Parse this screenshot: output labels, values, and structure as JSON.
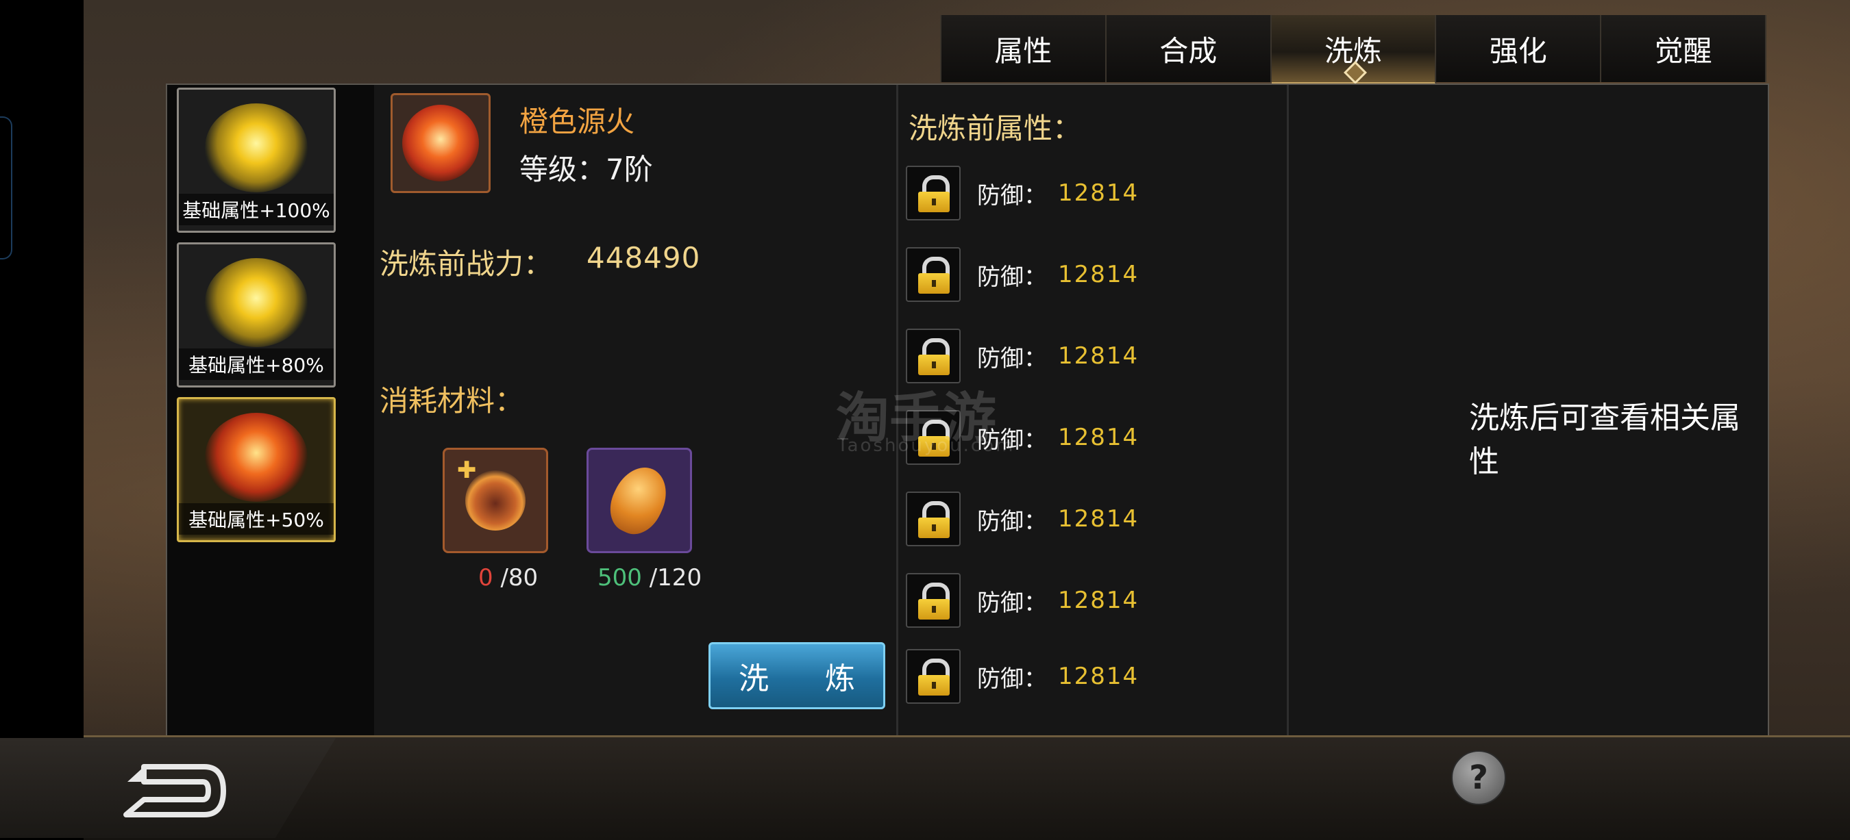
{
  "tabs": [
    {
      "label": "属性",
      "active": false
    },
    {
      "label": "合成",
      "active": false
    },
    {
      "label": "洗炼",
      "active": true
    },
    {
      "label": "强化",
      "active": false
    },
    {
      "label": "觉醒",
      "active": false
    }
  ],
  "slots": [
    {
      "label": "基础属性+100%",
      "orb": "gold",
      "selected": false
    },
    {
      "label": "基础属性+80%",
      "orb": "gold",
      "selected": false
    },
    {
      "label": "基础属性+50%",
      "orb": "red",
      "selected": true
    }
  ],
  "item": {
    "name": "橙色源火",
    "level": "等级：7阶"
  },
  "power": {
    "label": "洗炼前战力：",
    "value": "448490"
  },
  "materials": {
    "label": "消耗材料：",
    "items": [
      {
        "icon": "fire-essence-icon",
        "have": "0",
        "need": "/80"
      },
      {
        "icon": "amber-stone-icon",
        "have": "500",
        "need": "/120"
      }
    ]
  },
  "refine_button": {
    "char1": "洗",
    "char2": "炼"
  },
  "attributes": {
    "title": "洗炼前属性：",
    "rows": [
      {
        "name": "防御：",
        "value": "12814"
      },
      {
        "name": "防御：",
        "value": "12814"
      },
      {
        "name": "防御：",
        "value": "12814"
      },
      {
        "name": "防御：",
        "value": "12814"
      },
      {
        "name": "防御：",
        "value": "12814"
      },
      {
        "name": "防御：",
        "value": "12814"
      },
      {
        "name": "防御：",
        "value": "12814"
      }
    ]
  },
  "after_note": "洗炼后可查看相关属性",
  "watermark": {
    "main": "淘手游",
    "sub": "Taoshouyou.com"
  },
  "help": "?"
}
